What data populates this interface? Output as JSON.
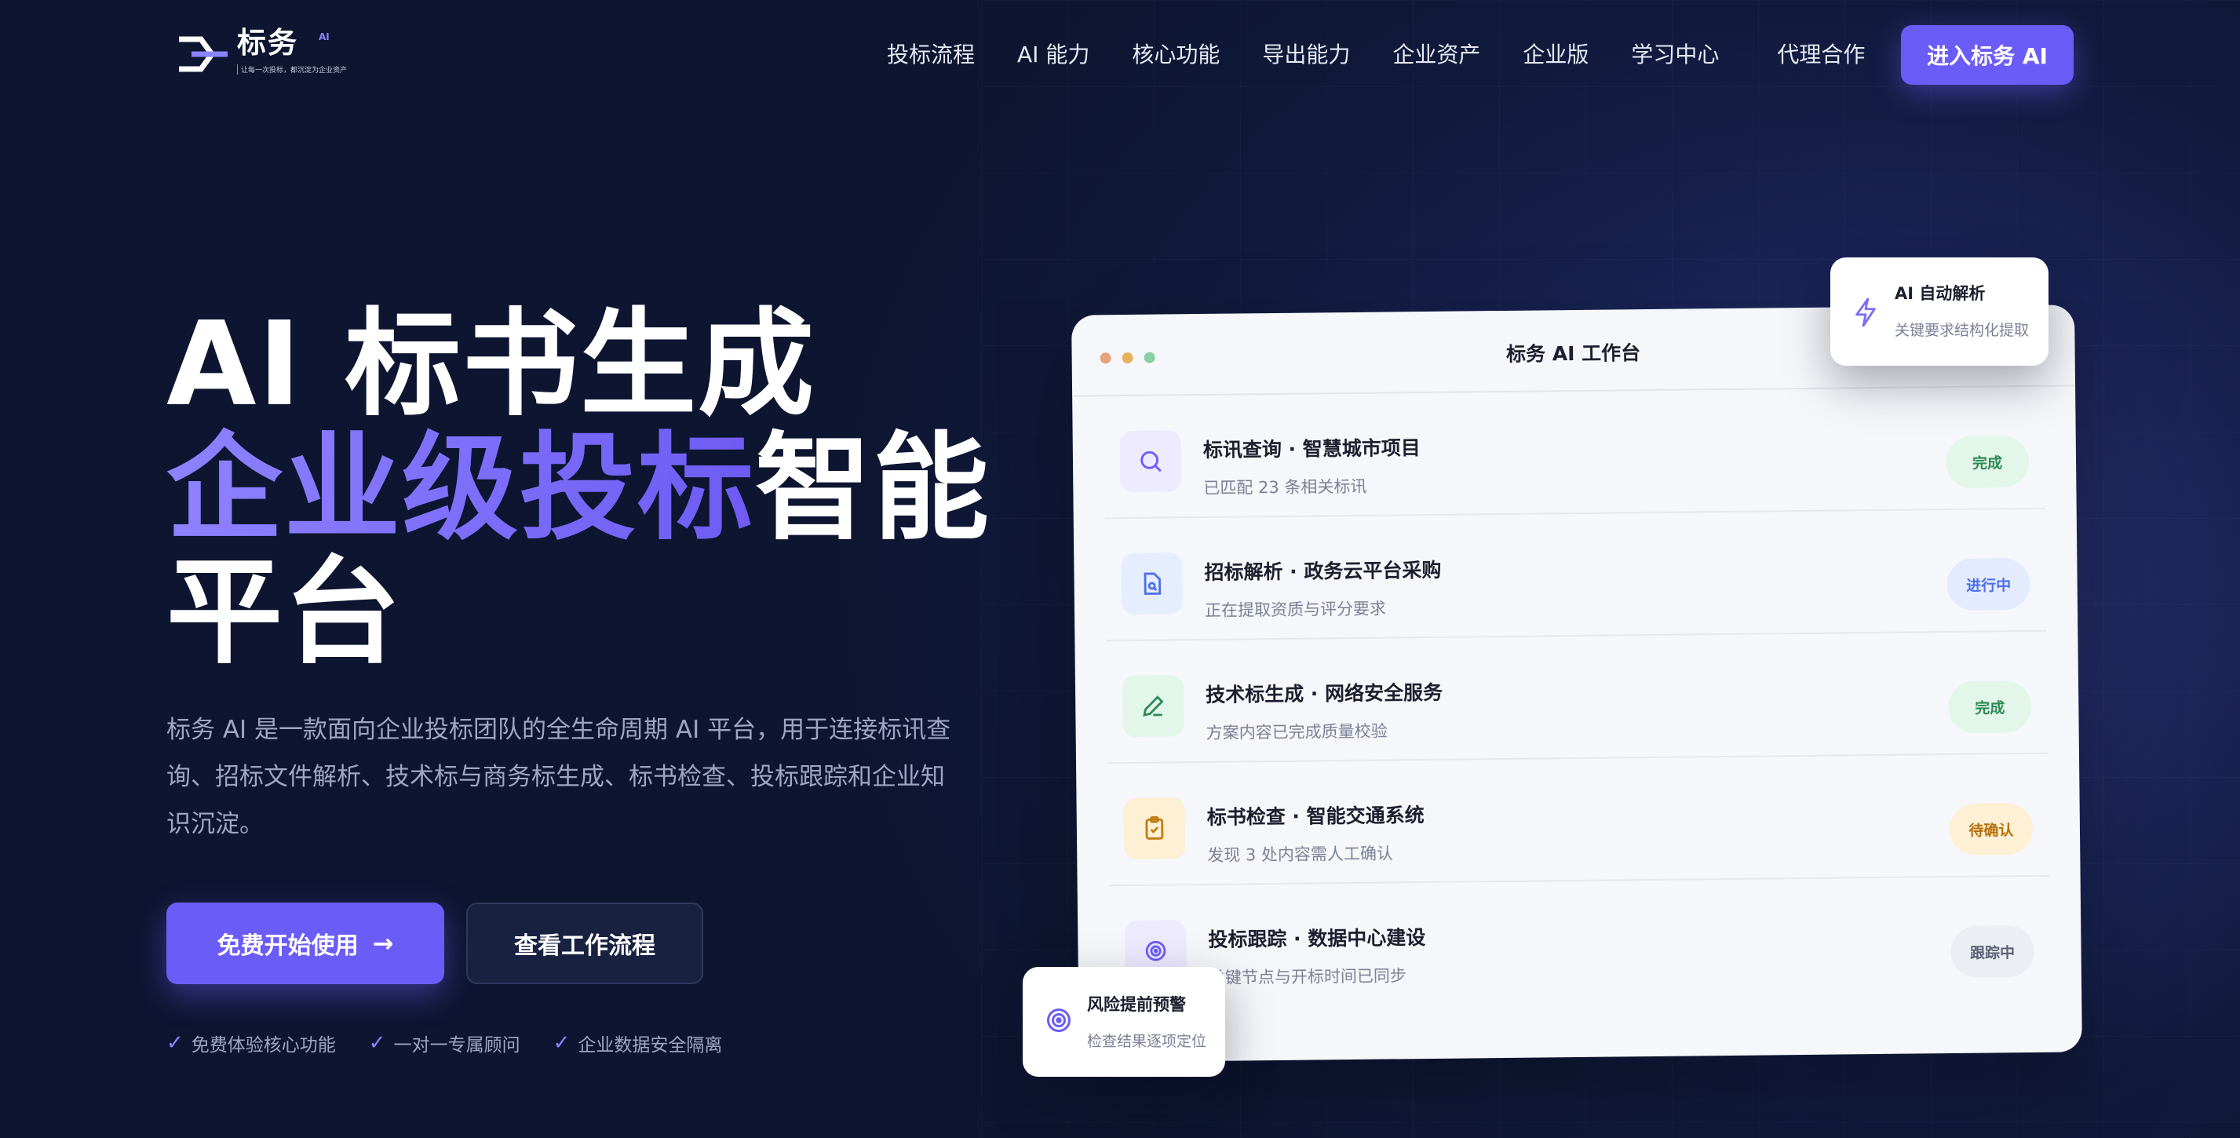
{
  "brand": {
    "name": "标务",
    "superscript": "AI",
    "tagline": "让每一次投标，都沉淀为企业资产",
    "accent_color": "#6c5cf7"
  },
  "nav": {
    "items": [
      "投标流程",
      "AI 能力",
      "核心功能",
      "导出能力",
      "企业资产",
      "企业版",
      "学习中心",
      "代理合作"
    ],
    "cta": "进入标务 AI"
  },
  "hero": {
    "title_line1": "AI 标书生成",
    "title_line2_accent": "企业级投标",
    "title_line2_rest": "智能",
    "title_line3": "平台",
    "description": "标务 AI 是一款面向企业投标团队的全生命周期 AI 平台，用于连接标讯查询、招标文件解析、技术标与商务标生成、标书检查、投标跟踪和企业知识沉淀。",
    "primary_button": "免费开始使用",
    "secondary_button": "查看工作流程",
    "features": [
      "免费体验核心功能",
      "一对一专属顾问",
      "企业数据安全隔离"
    ]
  },
  "workbench": {
    "title": "标务 AI 工作台",
    "rows": [
      {
        "title": "标讯查询 · 智慧城市项目",
        "subtitle": "已匹配 23 条相关标讯",
        "status": "完成",
        "icon": "search-icon"
      },
      {
        "title": "招标解析 · 政务云平台采购",
        "subtitle": "正在提取资质与评分要求",
        "status": "进行中",
        "icon": "document-search-icon"
      },
      {
        "title": "技术标生成 · 网络安全服务",
        "subtitle": "方案内容已完成质量校验",
        "status": "完成",
        "icon": "pen-icon"
      },
      {
        "title": "标书检查 · 智能交通系统",
        "subtitle": "发现 3 处内容需人工确认",
        "status": "待确认",
        "icon": "clipboard-check-icon"
      },
      {
        "title": "投标跟踪 · 数据中心建设",
        "subtitle": "关键节点与开标时间已同步",
        "status": "跟踪中",
        "icon": "target-icon"
      }
    ]
  },
  "float_cards": {
    "top": {
      "title": "AI 自动解析",
      "subtitle": "关键要求结构化提取",
      "icon": "lightning-icon"
    },
    "bottom": {
      "title": "风险提前预警",
      "subtitle": "检查结果逐项定位",
      "icon": "radar-icon"
    }
  }
}
